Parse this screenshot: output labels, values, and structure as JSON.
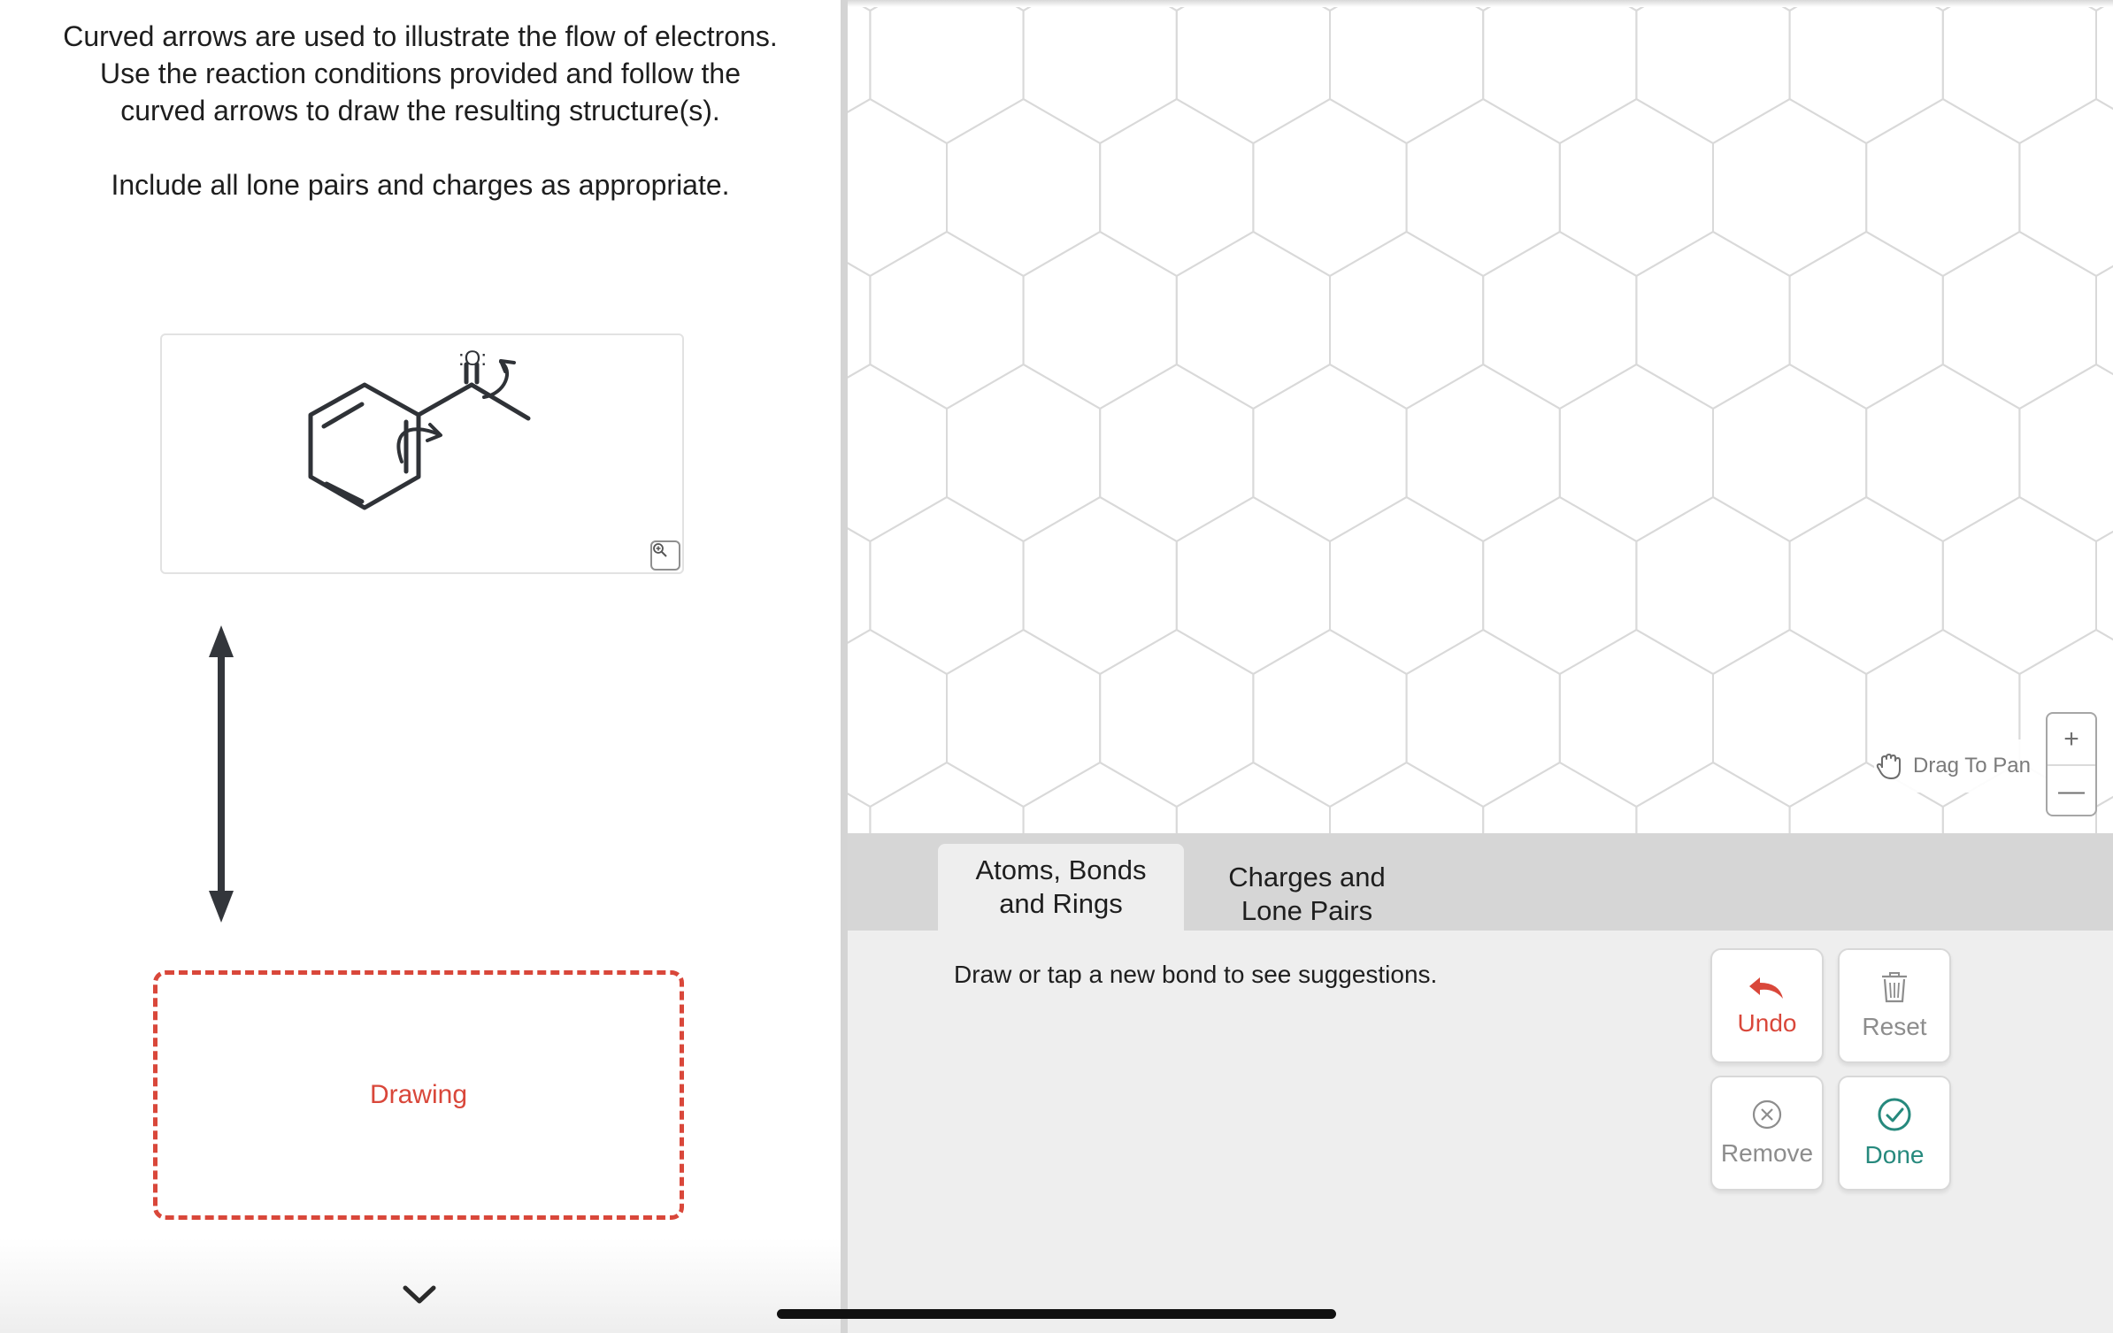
{
  "instructions": {
    "line1": "Curved arrows are used to illustrate the flow of electrons.",
    "line2": "Use the reaction conditions provided and follow the",
    "line3": "curved arrows to draw the resulting structure(s).",
    "line4": "Include all lone pairs and charges as appropriate."
  },
  "molecule": {
    "oxygen_label": ":O:",
    "zoom_icon": "magnifier-plus-icon"
  },
  "drawing_box": {
    "label": "Drawing"
  },
  "canvas": {
    "pan_hint": "Drag To Pan",
    "pan_icon": "hand-icon",
    "zoom_in": "+",
    "zoom_out": "—"
  },
  "tabs": [
    {
      "label": "Atoms, Bonds and Rings",
      "line1": "Atoms, Bonds",
      "line2": "and Rings",
      "active": true
    },
    {
      "label": "Charges and Lone Pairs",
      "line1": "Charges and",
      "line2": "Lone Pairs",
      "active": false
    }
  ],
  "tools": {
    "hint": "Draw or tap a new bond to see suggestions.",
    "buttons": {
      "undo": "Undo",
      "reset": "Reset",
      "remove": "Remove",
      "done": "Done"
    }
  },
  "colors": {
    "accent_red": "#d9473a",
    "done_teal": "#26897d",
    "grid_line": "#d9d9d9",
    "structure": "#2f3237"
  }
}
